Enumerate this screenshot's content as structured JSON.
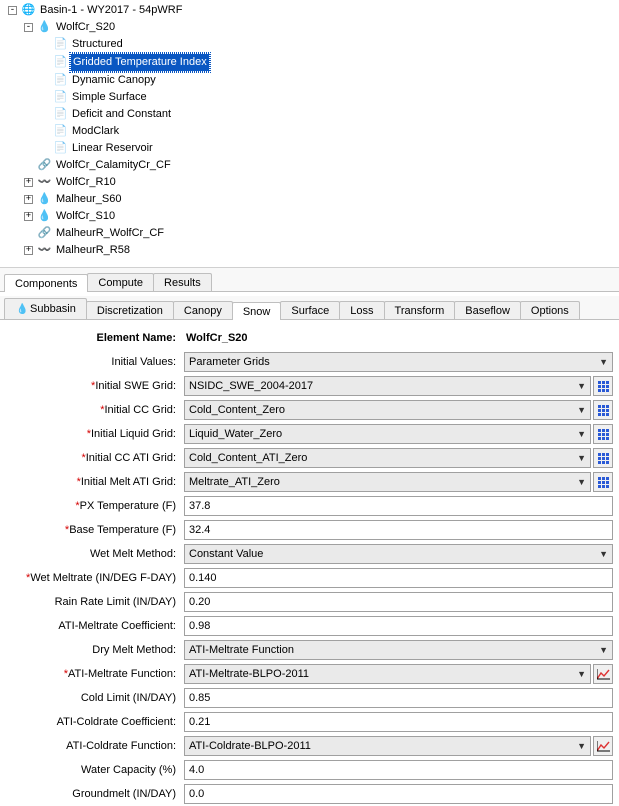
{
  "tree": {
    "root": "Basin-1 - WY2017  - 54pWRF",
    "wolfcr_s20": "WolfCr_S20",
    "structured": "Structured",
    "gti": "Gridded Temperature Index",
    "dyn_canopy": "Dynamic Canopy",
    "simple_surface": "Simple Surface",
    "deficit_constant": "Deficit and Constant",
    "modclark": "ModClark",
    "linear_res": "Linear Reservoir",
    "calamity_cf": "WolfCr_CalamityCr_CF",
    "wolfcr_r10": "WolfCr_R10",
    "malheur_s60": "Malheur_S60",
    "wolfcr_s10": "WolfCr_S10",
    "malheurr_wolfcr_cf": "MalheurR_WolfCr_CF",
    "malheurr_r58": "MalheurR_R58"
  },
  "tabs1": {
    "components": "Components",
    "compute": "Compute",
    "results": "Results"
  },
  "tabs2": {
    "subbasin": "Subbasin",
    "discretization": "Discretization",
    "canopy": "Canopy",
    "snow": "Snow",
    "surface": "Surface",
    "loss": "Loss",
    "transform": "Transform",
    "baseflow": "Baseflow",
    "options": "Options"
  },
  "form": {
    "element_name_label": "Element Name:",
    "element_name_value": "WolfCr_S20",
    "initial_values_label": "Initial Values:",
    "initial_values_value": "Parameter Grids",
    "initial_swe_grid_label": "Initial SWE Grid:",
    "initial_swe_grid_value": "NSIDC_SWE_2004-2017",
    "initial_cc_grid_label": "Initial CC Grid:",
    "initial_cc_grid_value": "Cold_Content_Zero",
    "initial_liquid_grid_label": "Initial Liquid Grid:",
    "initial_liquid_grid_value": "Liquid_Water_Zero",
    "initial_cc_ati_grid_label": "Initial CC ATI Grid:",
    "initial_cc_ati_grid_value": "Cold_Content_ATI_Zero",
    "initial_melt_ati_grid_label": "Initial Melt ATI Grid:",
    "initial_melt_ati_grid_value": "Meltrate_ATI_Zero",
    "px_temp_label": "PX Temperature (F)",
    "px_temp_value": "37.8",
    "base_temp_label": "Base Temperature (F)",
    "base_temp_value": "32.4",
    "wet_melt_method_label": "Wet Melt Method:",
    "wet_melt_method_value": "Constant Value",
    "wet_meltrate_label": "Wet Meltrate (IN/DEG F-DAY)",
    "wet_meltrate_value": "0.140",
    "rain_rate_limit_label": "Rain Rate Limit (IN/DAY)",
    "rain_rate_limit_value": "0.20",
    "ati_meltrate_coeff_label": "ATI-Meltrate Coefficient:",
    "ati_meltrate_coeff_value": "0.98",
    "dry_melt_method_label": "Dry Melt Method:",
    "dry_melt_method_value": "ATI-Meltrate Function",
    "ati_meltrate_func_label": "ATI-Meltrate Function:",
    "ati_meltrate_func_value": "ATI-Meltrate-BLPO-2011",
    "cold_limit_label": "Cold Limit (IN/DAY)",
    "cold_limit_value": "0.85",
    "ati_coldrate_coeff_label": "ATI-Coldrate Coefficient:",
    "ati_coldrate_coeff_value": "0.21",
    "ati_coldrate_func_label": "ATI-Coldrate Function:",
    "ati_coldrate_func_value": "ATI-Coldrate-BLPO-2011",
    "water_capacity_label": "Water Capacity (%)",
    "water_capacity_value": "4.0",
    "groundmelt_label": "Groundmelt (IN/DAY)",
    "groundmelt_value": "0.0"
  }
}
